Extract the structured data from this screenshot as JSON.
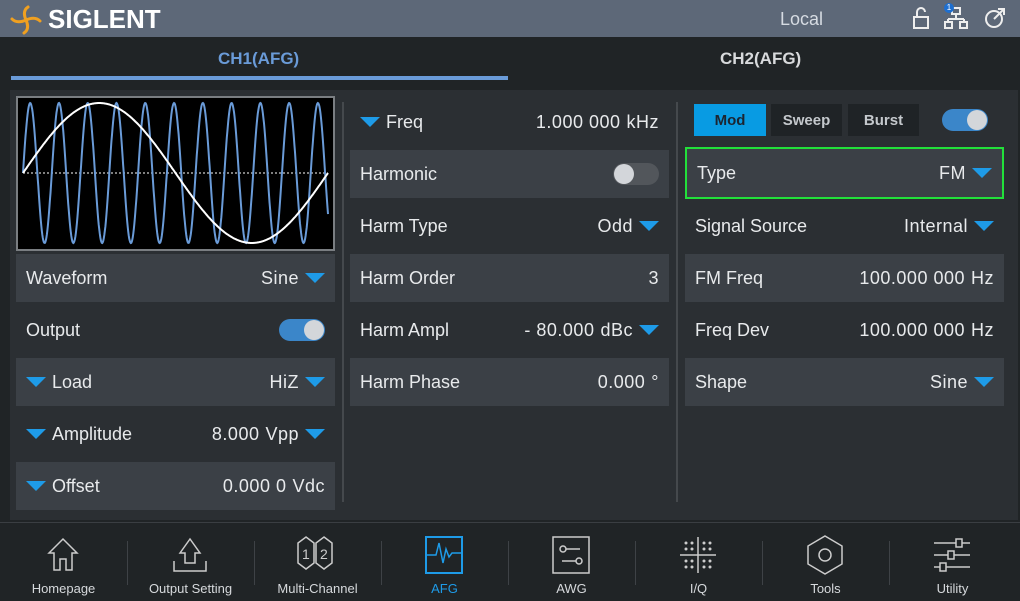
{
  "header": {
    "brand": "SIGLENT",
    "mode": "Local",
    "network_badge": "1",
    "icons": [
      "lock-open-icon",
      "network-icon",
      "external-control-icon"
    ]
  },
  "tabs": [
    {
      "label": "CH1(AFG)",
      "active": true
    },
    {
      "label": "CH2(AFG)",
      "active": false
    }
  ],
  "left": {
    "waveform": {
      "label": "Waveform",
      "value": "Sine"
    },
    "output": {
      "label": "Output",
      "on": true
    },
    "load": {
      "label": "Load",
      "value": "HiZ"
    },
    "amplitude": {
      "label": "Amplitude",
      "value": "8.000",
      "unit": "Vpp"
    },
    "offset": {
      "label": "Offset",
      "value": "0.000 0",
      "unit": "Vdc"
    }
  },
  "middle": {
    "freq": {
      "label": "Freq",
      "value": "1.000 000",
      "unit": "kHz"
    },
    "harmonic": {
      "label": "Harmonic",
      "on": false
    },
    "harm_type": {
      "label": "Harm Type",
      "value": "Odd"
    },
    "harm_order": {
      "label": "Harm Order",
      "value": "3"
    },
    "harm_ampl": {
      "label": "Harm Ampl",
      "value": "- 80.000",
      "unit": "dBc"
    },
    "harm_phase": {
      "label": "Harm Phase",
      "value": "0.000",
      "unit": "°"
    }
  },
  "right": {
    "modes": [
      {
        "label": "Mod",
        "active": true
      },
      {
        "label": "Sweep",
        "active": false
      },
      {
        "label": "Burst",
        "active": false
      }
    ],
    "mod_enabled": true,
    "type": {
      "label": "Type",
      "value": "FM"
    },
    "signal_source": {
      "label": "Signal Source",
      "value": "Internal"
    },
    "fm_freq": {
      "label": "FM Freq",
      "value": "100.000 000",
      "unit": "Hz"
    },
    "freq_dev": {
      "label": "Freq Dev",
      "value": "100.000 000",
      "unit": "Hz"
    },
    "shape": {
      "label": "Shape",
      "value": "Sine"
    }
  },
  "nav": [
    {
      "label": "Homepage"
    },
    {
      "label": "Output Setting"
    },
    {
      "label": "Multi-Channel"
    },
    {
      "label": "AFG",
      "active": true
    },
    {
      "label": "AWG"
    },
    {
      "label": "I/Q"
    },
    {
      "label": "Tools"
    },
    {
      "label": "Utility"
    }
  ],
  "colors": {
    "accent": "#1e9be8",
    "tab_active": "#6a9bd8",
    "highlight": "#22e03a",
    "carrier": "#6a9bd8"
  }
}
